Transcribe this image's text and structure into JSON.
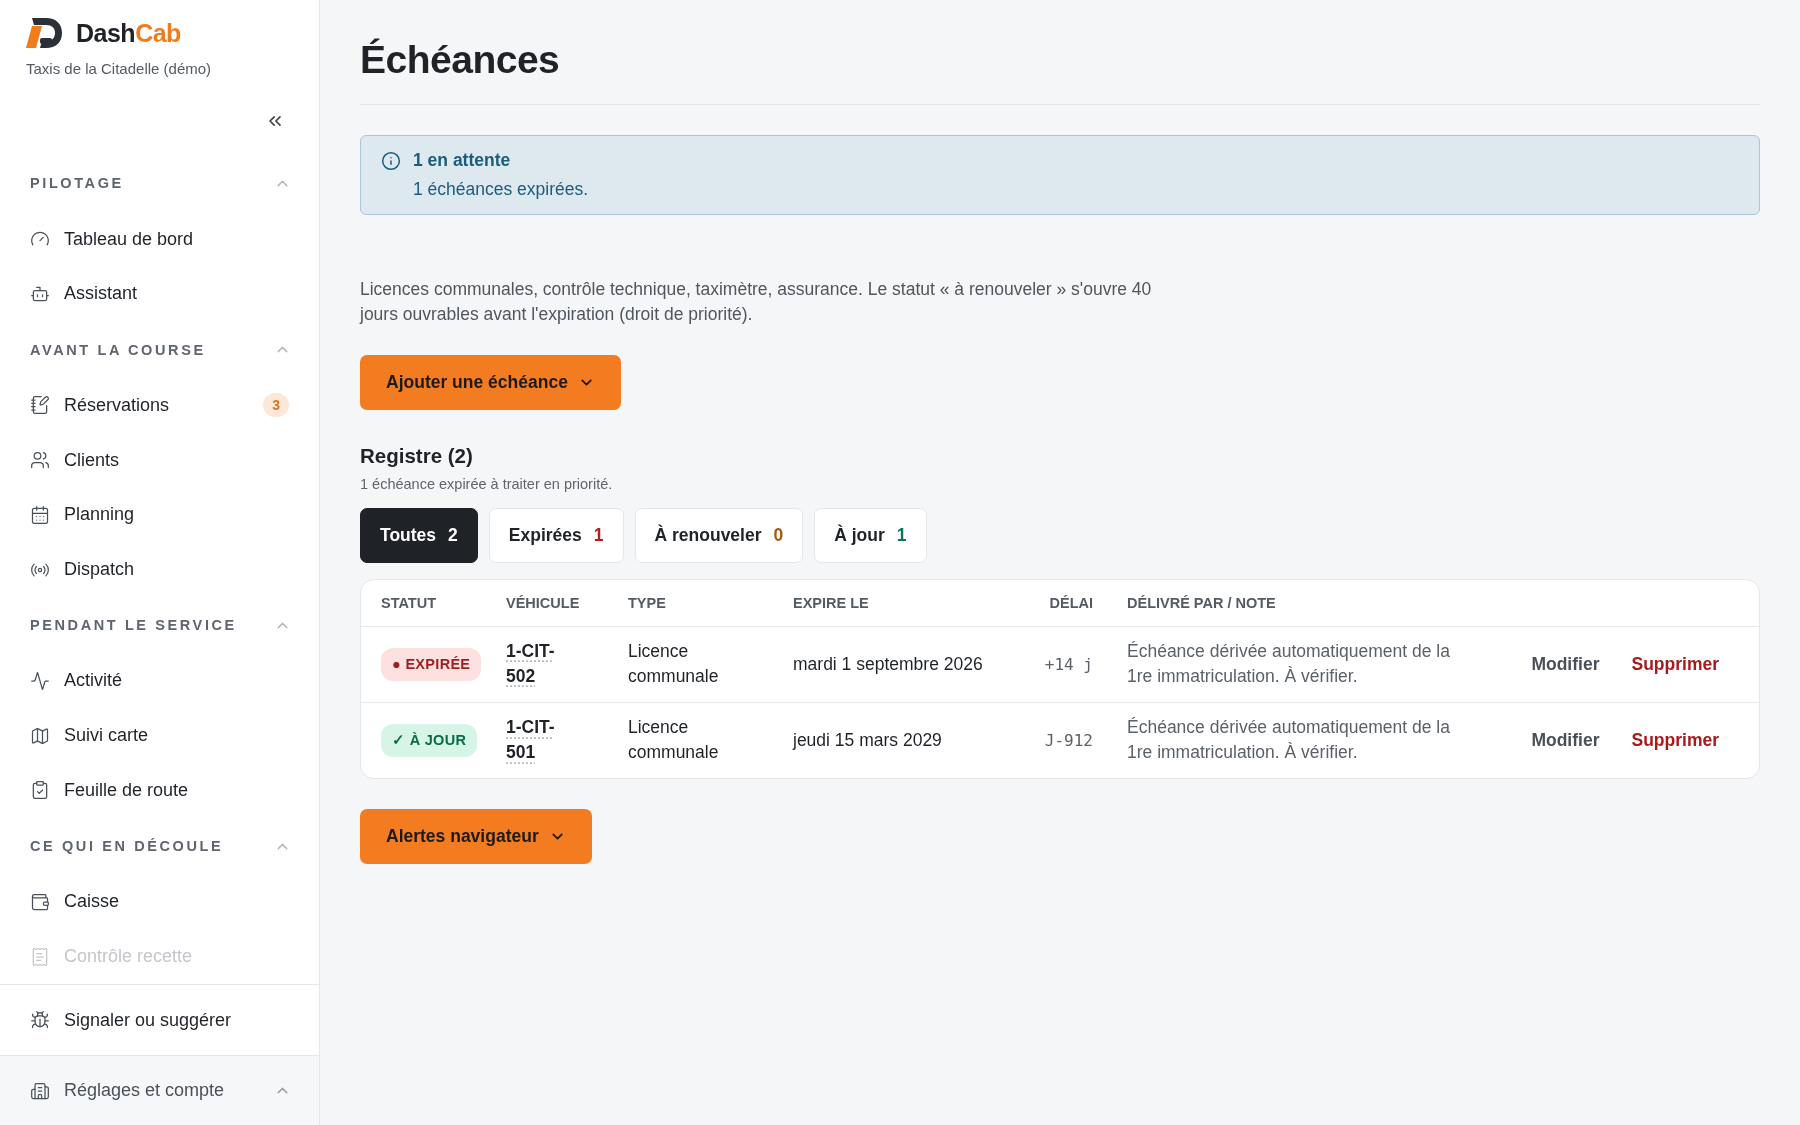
{
  "brand": {
    "name_start": "Dash",
    "name_end": "Cab",
    "organization": "Taxis de la Citadelle (démo)"
  },
  "sidebar": {
    "sections": [
      {
        "title": "PILOTAGE",
        "expanded": true,
        "items": [
          {
            "label": "Tableau de bord"
          },
          {
            "label": "Assistant"
          }
        ]
      },
      {
        "title": "AVANT LA COURSE",
        "expanded": true,
        "items": [
          {
            "label": "Réservations",
            "badge": "3"
          },
          {
            "label": "Clients"
          },
          {
            "label": "Planning"
          },
          {
            "label": "Dispatch"
          }
        ]
      },
      {
        "title": "PENDANT LE SERVICE",
        "expanded": true,
        "items": [
          {
            "label": "Activité"
          },
          {
            "label": "Suivi carte"
          },
          {
            "label": "Feuille de route"
          }
        ]
      },
      {
        "title": "CE QUI EN DÉCOULE",
        "expanded": true,
        "items": [
          {
            "label": "Caisse"
          },
          {
            "label": "Contrôle recette",
            "faded": true
          }
        ]
      }
    ],
    "feedback": "Signaler ou suggérer",
    "settings": {
      "label": "Réglages et compte",
      "expanded": true
    }
  },
  "page": {
    "title": "Échéances",
    "notice": {
      "title": "1 en attente",
      "message": "1 échéances expirées."
    },
    "description": "Licences communales, contrôle technique, taximètre, assurance. Le statut « à renouveler » s'ouvre 40 jours ouvrables avant l'expiration (droit de priorité).",
    "add_button": "Ajouter une échéance",
    "register": {
      "title": "Registre (2)",
      "subtitle": "1 échéance expirée à traiter en priorité.",
      "tabs": [
        {
          "label": "Toutes",
          "count": "2",
          "selected": true
        },
        {
          "label": "Expirées",
          "count": "1",
          "selected": false,
          "color": "#b91c1c"
        },
        {
          "label": "À renouveler",
          "count": "0",
          "selected": false,
          "color": "#a35a0c"
        },
        {
          "label": "À jour",
          "count": "1",
          "selected": false,
          "color": "#047857"
        }
      ],
      "table": {
        "columns": [
          "STATUT",
          "VÉHICULE",
          "TYPE",
          "EXPIRE LE",
          "DÉLAI",
          "DÉLIVRÉ PAR / NOTE"
        ],
        "rows": [
          {
            "status": "● EXPIRÉE",
            "kind": "expired",
            "vehicle": "1-CIT-502",
            "type": "Licence communale",
            "expires": "mardi 1 septembre 2026",
            "delay": "+14 j",
            "note": "Échéance dérivée automatiquement de la 1re immatriculation. À vérifier.",
            "edit": "Modifier",
            "delete": "Supprimer"
          },
          {
            "status": "✓ À JOUR",
            "kind": "ok",
            "vehicle": "1-CIT-501",
            "type": "Licence communale",
            "expires": "jeudi 15 mars 2029",
            "delay": "J-912",
            "note": "Échéance dérivée automatiquement de la 1re immatriculation. À vérifier.",
            "edit": "Modifier",
            "delete": "Supprimer"
          }
        ]
      }
    },
    "alerts_button": "Alertes navigateur"
  }
}
